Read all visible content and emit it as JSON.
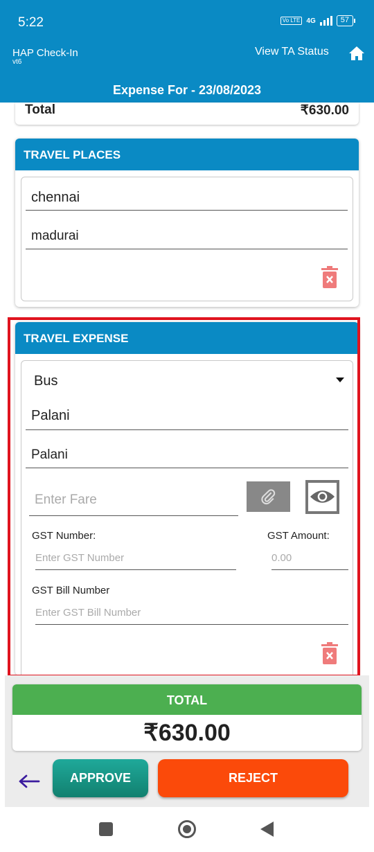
{
  "status_bar": {
    "time": "5:22",
    "volte": "Vo LTE",
    "network": "4G",
    "battery": "57"
  },
  "header": {
    "app_name": "HAP Check-In",
    "app_version": "vt6",
    "view_ta_status": "View TA Status",
    "home_icon": "home-icon",
    "title": "Expense For - 23/08/2023"
  },
  "summary": {
    "total_label": "Total",
    "total_value": "₹630.00"
  },
  "travel_places": {
    "title": "TRAVEL PLACES",
    "from": "chennai",
    "to": "madurai"
  },
  "travel_expense": {
    "title": "TRAVEL EXPENSE",
    "mode": "Bus",
    "from": "Palani",
    "to": "Palani",
    "fare_placeholder": "Enter Fare",
    "gst_number_label": "GST Number:",
    "gst_number_placeholder": "Enter GST Number",
    "gst_amount_label": "GST Amount:",
    "gst_amount_placeholder": "0.00",
    "gst_bill_label": "GST Bill Number",
    "gst_bill_placeholder": "Enter GST Bill Number"
  },
  "footer": {
    "total_label": "TOTAL",
    "total_amount": "₹630.00",
    "approve": "APPROVE",
    "reject": "REJECT"
  },
  "colors": {
    "header_blue": "#0a8ac4",
    "total_green": "#4caf50",
    "approve_teal": "#12806f",
    "reject_orange": "#fb4a0a",
    "delete_red": "#ef7b7b",
    "highlight_red": "#e0141f",
    "back_arrow": "#3b1c9e"
  }
}
